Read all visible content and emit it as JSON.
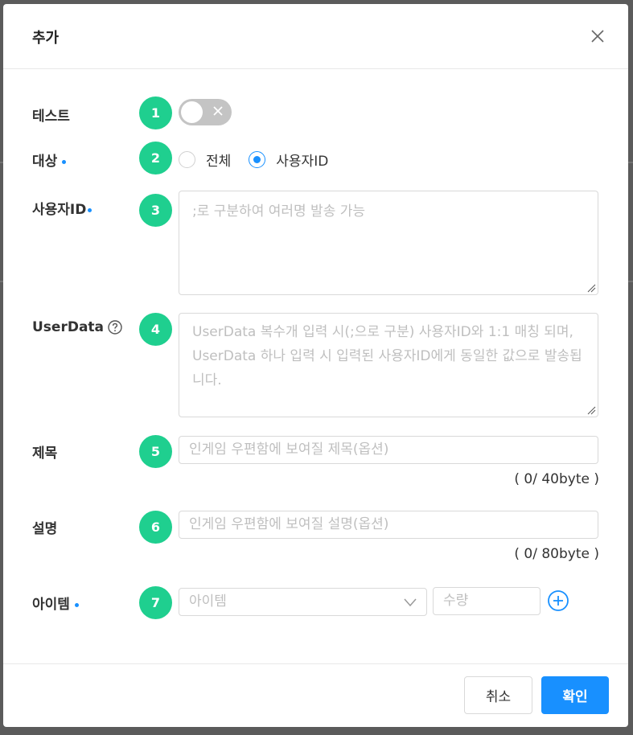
{
  "dialog": {
    "title": "추가",
    "close_icon": "close-icon"
  },
  "form": {
    "test": {
      "label": "테스트",
      "step": "1",
      "toggle_on": false
    },
    "target": {
      "label": "대상",
      "step": "2",
      "options": [
        {
          "label": "전체",
          "checked": false
        },
        {
          "label": "사용자ID",
          "checked": true
        }
      ]
    },
    "user_id": {
      "label": "사용자ID",
      "step": "3",
      "placeholder": ";로 구분하여 여러명 발송 가능"
    },
    "user_data": {
      "label": "UserData",
      "help_icon": "question-circle-icon",
      "step": "4",
      "placeholder": "UserData 복수개 입력 시(;으로 구분) 사용자ID와 1:1 매칭 되며, UserData 하나 입력 시 입력된 사용자ID에게 동일한 값으로 발송됩니다."
    },
    "subject": {
      "label": "제목",
      "step": "5",
      "placeholder": "인게임 우편함에 보여질 제목(옵션)",
      "counter": "( 0/ 40byte )"
    },
    "description": {
      "label": "설명",
      "step": "6",
      "placeholder": "인게임 우편함에 보여질 설명(옵션)",
      "counter": "( 0/ 80byte )"
    },
    "item": {
      "label": "아이템",
      "step": "7",
      "select_placeholder": "아이템",
      "quantity_placeholder": "수량",
      "add_icon": "plus-circle-icon"
    }
  },
  "footer": {
    "cancel_label": "취소",
    "ok_label": "확인"
  },
  "colors": {
    "accent": "#1890ff",
    "step_badge": "#1fcf8f",
    "toggle_off": "#c4c4c4"
  }
}
